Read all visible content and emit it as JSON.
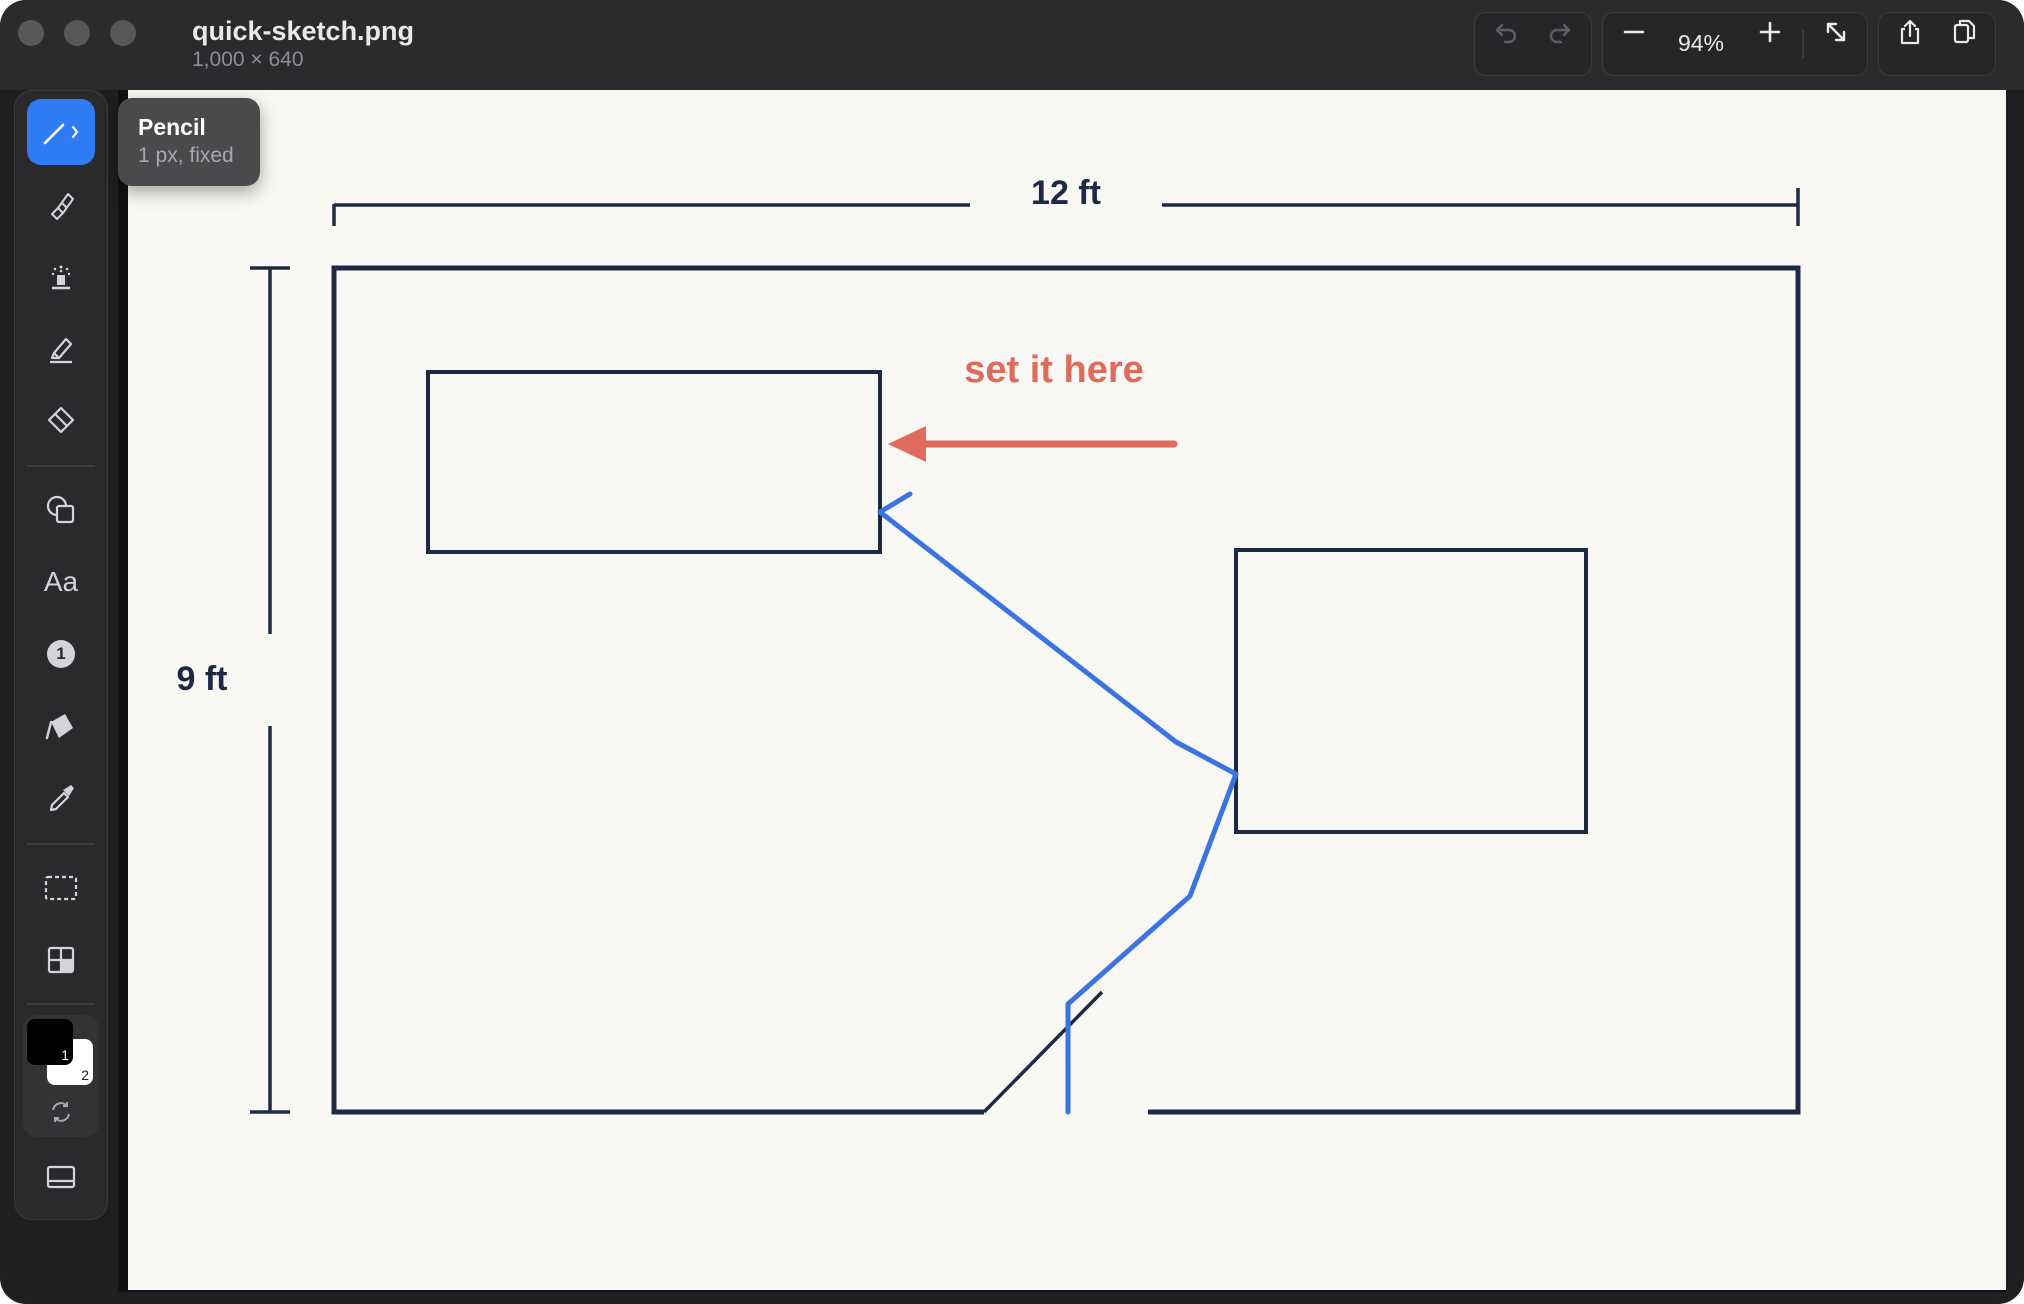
{
  "window": {
    "file_name": "quick-sketch.png",
    "dimensions": "1,000 × 640"
  },
  "header": {
    "zoom_level": "94%"
  },
  "tooltip": {
    "title": "Pencil",
    "subtitle": "1 px, fixed"
  },
  "toolbar": {
    "tools": [
      {
        "icon": "pencil-icon",
        "active": true
      },
      {
        "icon": "brush-icon"
      },
      {
        "icon": "spray-icon"
      },
      {
        "icon": "highlighter-icon"
      },
      {
        "icon": "eraser-icon"
      },
      {
        "icon": "shapes-icon"
      },
      {
        "icon": "text-icon",
        "label": "Aa"
      },
      {
        "icon": "counter-icon",
        "label": "1"
      },
      {
        "icon": "fill-bucket-icon"
      },
      {
        "icon": "eyedropper-icon"
      },
      {
        "icon": "selection-icon"
      },
      {
        "icon": "grid-icon"
      }
    ],
    "color_slots": {
      "primary_label": "1",
      "secondary_label": "2",
      "primary_color": "#000000",
      "secondary_color": "#ffffff"
    }
  },
  "sketch": {
    "width_label": "12 ft",
    "height_label": "9 ft",
    "annotation": "set it here",
    "colors": {
      "ink": "#1e2a44",
      "annotation": "#e06b5c",
      "pencil": "#3b74e0",
      "paper": "#f9f8f4",
      "accent": "#2f7cf6"
    }
  }
}
